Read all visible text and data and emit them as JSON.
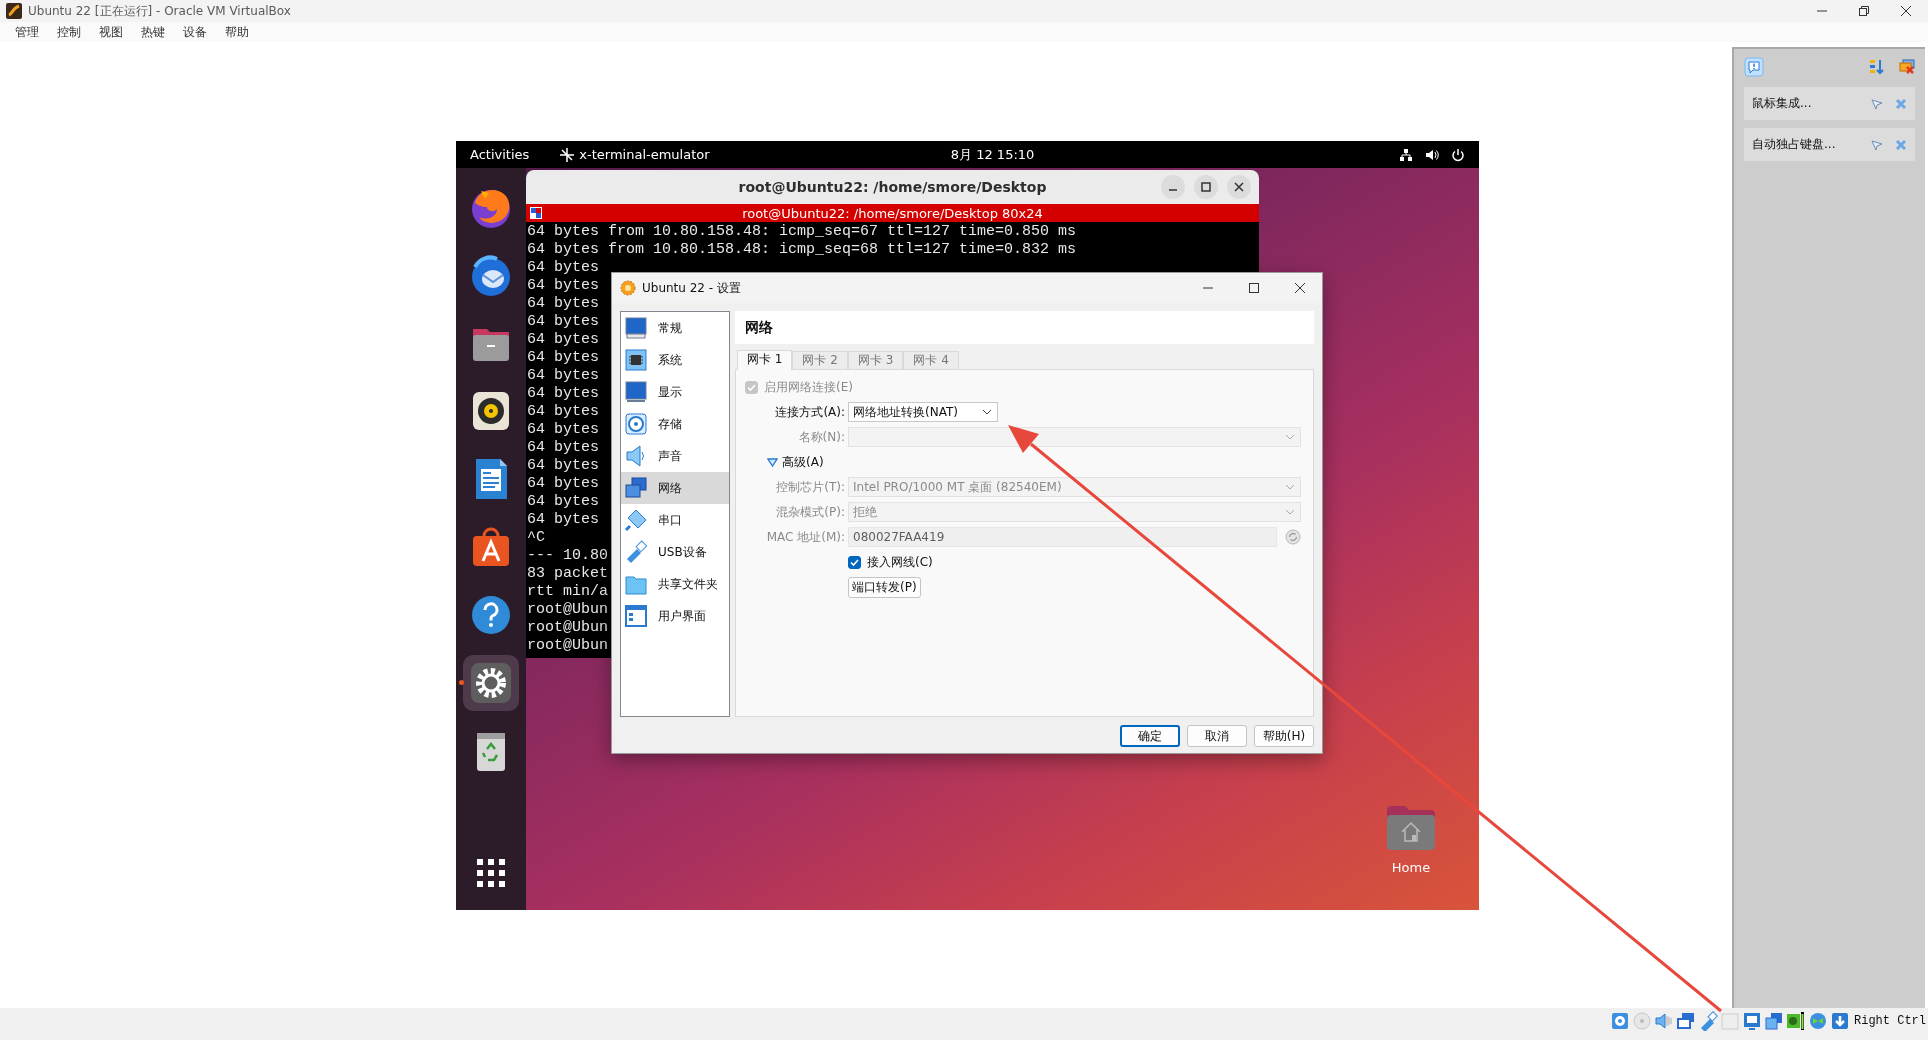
{
  "window": {
    "title": "Ubuntu 22 [正在运行] - Oracle VM VirtualBox"
  },
  "menu_bar": [
    "管理",
    "控制",
    "视图",
    "热键",
    "设备",
    "帮助"
  ],
  "guest": {
    "top_bar": {
      "activities": "Activities",
      "app_name": "x-terminal-emulator",
      "clock": "8月 12 15:10"
    },
    "dock": [
      {
        "kind": "browser",
        "running": false
      },
      {
        "kind": "mail",
        "running": false
      },
      {
        "kind": "files",
        "running": false
      },
      {
        "kind": "music",
        "running": false
      },
      {
        "kind": "writer",
        "running": false
      },
      {
        "kind": "store",
        "running": false
      },
      {
        "kind": "help",
        "running": false
      },
      {
        "kind": "settings",
        "running": true
      },
      {
        "kind": "trash",
        "running": false
      },
      {
        "kind": "apps",
        "running": false
      }
    ],
    "desktop_icons": [
      {
        "label": "Home"
      }
    ],
    "terminal": {
      "title": "root@Ubuntu22: /home/smore/Desktop",
      "banner": "root@Ubuntu22: /home/smore/Desktop 80x24",
      "lines": [
        "64 bytes from 10.80.158.48: icmp_seq=67 ttl=127 time=0.850 ms",
        "64 bytes from 10.80.158.48: icmp_seq=68 ttl=127 time=0.832 ms",
        "64 bytes",
        "64 bytes",
        "64 bytes",
        "64 bytes",
        "64 bytes",
        "64 bytes",
        "64 bytes",
        "64 bytes",
        "64 bytes",
        "64 bytes",
        "64 bytes",
        "64 bytes",
        "64 bytes",
        "64 bytes",
        "64 bytes",
        "^C",
        "--- 10.80",
        "83 packet",
        "rtt min/a",
        "root@Ubun",
        "root@Ubun",
        "root@Ubun"
      ]
    }
  },
  "settings_dialog": {
    "title": "Ubuntu 22 - 设置",
    "categories": [
      {
        "kind": "general",
        "label": "常规",
        "selected": false
      },
      {
        "kind": "system",
        "label": "系统",
        "selected": false
      },
      {
        "kind": "display",
        "label": "显示",
        "selected": false
      },
      {
        "kind": "storage",
        "label": "存储",
        "selected": false
      },
      {
        "kind": "audio",
        "label": "声音",
        "selected": false
      },
      {
        "kind": "network",
        "label": "网络",
        "selected": true
      },
      {
        "kind": "serial",
        "label": "串口",
        "selected": false
      },
      {
        "kind": "usb",
        "label": "USB设备",
        "selected": false
      },
      {
        "kind": "shared",
        "label": "共享文件夹",
        "selected": false
      },
      {
        "kind": "ui",
        "label": "用户界面",
        "selected": false
      }
    ],
    "page_title": "网络",
    "tabs": [
      {
        "label": "网卡 1",
        "selected": true
      },
      {
        "label": "网卡 2",
        "selected": false
      },
      {
        "label": "网卡 3",
        "selected": false
      },
      {
        "label": "网卡 4",
        "selected": false
      }
    ],
    "form": [
      {
        "kind": "checkbox",
        "label": "启用网络连接(E)",
        "checked": true,
        "disabled": true
      },
      {
        "kind": "select",
        "label": "连接方式(A):",
        "value": "网络地址转换(NAT)",
        "disabled": false
      },
      {
        "kind": "select",
        "label": "名称(N):",
        "disabled": true
      },
      {
        "kind": "expander",
        "label": "高级(A)",
        "expanded": true
      },
      {
        "kind": "select",
        "label": "控制芯片(T):",
        "value": "Intel PRO/1000 MT 桌面 (82540EM)",
        "disabled": true
      },
      {
        "kind": "select",
        "label": "混杂模式(P):",
        "value": "拒绝",
        "disabled": true
      },
      {
        "kind": "mac",
        "label": "MAC 地址(M):",
        "value": "080027FAA419",
        "disabled": true
      },
      {
        "kind": "field_checkbox",
        "label": "接入网线(C)",
        "checked": true,
        "disabled": false
      },
      {
        "kind": "button",
        "label": "端口转发(P)"
      }
    ],
    "buttons": [
      {
        "label": "确定",
        "default": true
      },
      {
        "label": "取消",
        "default": false
      },
      {
        "label": "帮助(H)",
        "default": false
      }
    ]
  },
  "notifications": [
    {
      "text": "鼠标集成..."
    },
    {
      "text": "自动独占键盘..."
    }
  ],
  "status_bar": {
    "host_key": "Right Ctrl"
  }
}
